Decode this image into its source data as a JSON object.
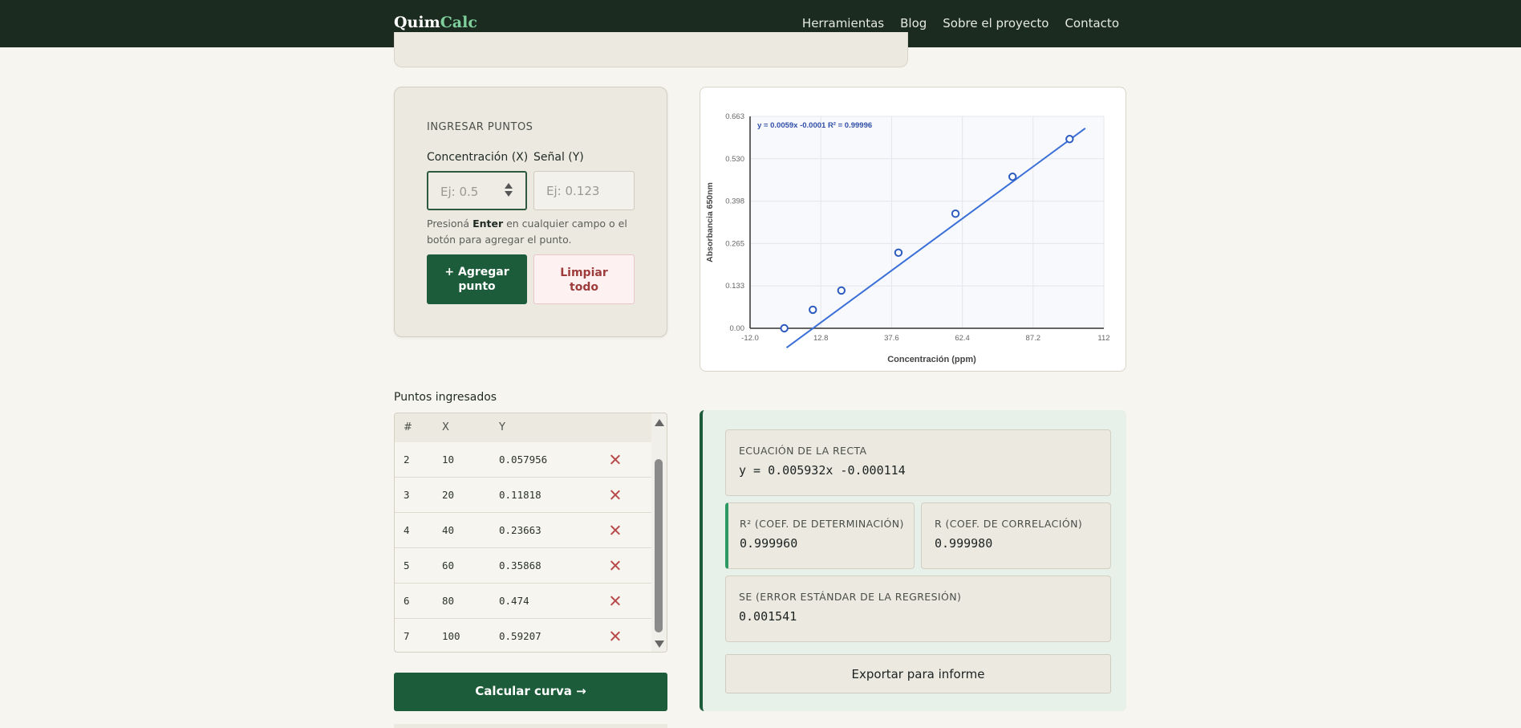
{
  "header": {
    "logo_part1": "Quim",
    "logo_part2": "Calc",
    "nav": [
      "Herramientas",
      "Blog",
      "Sobre el proyecto",
      "Contacto"
    ]
  },
  "input_panel": {
    "title": "INGRESAR PUNTOS",
    "x_label": "Concentración (X)",
    "y_label": "Señal (Y)",
    "x_placeholder": "Ej: 0.5",
    "y_placeholder": "Ej: 0.123",
    "hint_pre": "Presioná ",
    "hint_key": "Enter",
    "hint_post": " en cualquier campo o el botón para agregar el punto.",
    "add_line1": "+ Agregar",
    "add_line2": "punto",
    "clear_line1": "Limpiar",
    "clear_line2": "todo"
  },
  "chart_data": {
    "type": "scatter",
    "title": "",
    "xlabel": "Concentración (ppm)",
    "ylabel": "Absorbancia 650nm",
    "annotation": "y = 0.0059x  -0.0001    R² = 0.99996",
    "xlim": [
      -12.0,
      112
    ],
    "ylim": [
      0.0,
      0.663
    ],
    "x_ticks": [
      "-12.0",
      "12.8",
      "37.6",
      "62.4",
      "87.2",
      "112"
    ],
    "y_ticks": [
      "0.00",
      "0.133",
      "0.265",
      "0.398",
      "0.530",
      "0.663"
    ],
    "grid": true,
    "points": [
      {
        "x": 0,
        "y": 0.0
      },
      {
        "x": 10,
        "y": 0.057956
      },
      {
        "x": 20,
        "y": 0.11818
      },
      {
        "x": 40,
        "y": 0.23663
      },
      {
        "x": 60,
        "y": 0.35868
      },
      {
        "x": 80,
        "y": 0.474
      },
      {
        "x": 100,
        "y": 0.59207
      }
    ],
    "fit": {
      "slope": 0.005932,
      "intercept": -0.000114
    },
    "colors": {
      "line": "#3a6fd8",
      "point_stroke": "#2c5bbf",
      "annotation": "#2f4fa8"
    }
  },
  "points_table": {
    "title": "Puntos ingresados",
    "headers": [
      "#",
      "X",
      "Y"
    ],
    "rows": [
      {
        "n": "2",
        "x": "10",
        "y": "0.057956"
      },
      {
        "n": "3",
        "x": "20",
        "y": "0.11818"
      },
      {
        "n": "4",
        "x": "40",
        "y": "0.23663"
      },
      {
        "n": "5",
        "x": "60",
        "y": "0.35868"
      },
      {
        "n": "6",
        "x": "80",
        "y": "0.474"
      },
      {
        "n": "7",
        "x": "100",
        "y": "0.59207"
      }
    ]
  },
  "calc_button": "Calcular curva →",
  "results": {
    "equation_label": "ECUACIÓN DE LA RECTA",
    "equation_value": "y = 0.005932x -0.000114",
    "r2_label": "R² (COEF. DE DETERMINACIÓN)",
    "r2_value": "0.999960",
    "r_label": "R (COEF. DE CORRELACIÓN)",
    "r_value": "0.999980",
    "se_label": "SE (ERROR ESTÁNDAR DE LA REGRESIÓN)",
    "se_value": "0.001541",
    "export_label": "Exportar para informe"
  },
  "colors": {
    "header_bg": "#1b2b20",
    "brand_green": "#1d5c3a",
    "logo_accent": "#7fd09c",
    "danger": "#9e3b3b"
  }
}
